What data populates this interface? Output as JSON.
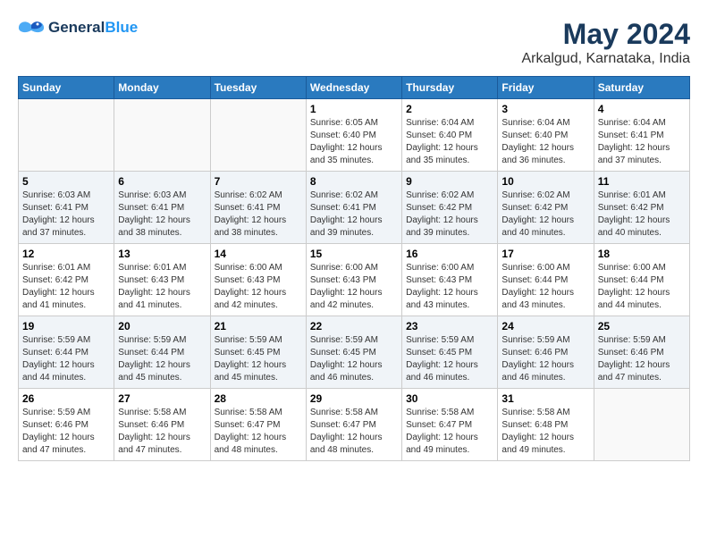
{
  "header": {
    "logo_text_general": "General",
    "logo_text_blue": "Blue",
    "title": "May 2024",
    "subtitle": "Arkalgud, Karnataka, India"
  },
  "calendar": {
    "weekdays": [
      "Sunday",
      "Monday",
      "Tuesday",
      "Wednesday",
      "Thursday",
      "Friday",
      "Saturday"
    ],
    "rows": [
      [
        {
          "day": "",
          "info": ""
        },
        {
          "day": "",
          "info": ""
        },
        {
          "day": "",
          "info": ""
        },
        {
          "day": "1",
          "info": "Sunrise: 6:05 AM\nSunset: 6:40 PM\nDaylight: 12 hours\nand 35 minutes."
        },
        {
          "day": "2",
          "info": "Sunrise: 6:04 AM\nSunset: 6:40 PM\nDaylight: 12 hours\nand 35 minutes."
        },
        {
          "day": "3",
          "info": "Sunrise: 6:04 AM\nSunset: 6:40 PM\nDaylight: 12 hours\nand 36 minutes."
        },
        {
          "day": "4",
          "info": "Sunrise: 6:04 AM\nSunset: 6:41 PM\nDaylight: 12 hours\nand 37 minutes."
        }
      ],
      [
        {
          "day": "5",
          "info": "Sunrise: 6:03 AM\nSunset: 6:41 PM\nDaylight: 12 hours\nand 37 minutes."
        },
        {
          "day": "6",
          "info": "Sunrise: 6:03 AM\nSunset: 6:41 PM\nDaylight: 12 hours\nand 38 minutes."
        },
        {
          "day": "7",
          "info": "Sunrise: 6:02 AM\nSunset: 6:41 PM\nDaylight: 12 hours\nand 38 minutes."
        },
        {
          "day": "8",
          "info": "Sunrise: 6:02 AM\nSunset: 6:41 PM\nDaylight: 12 hours\nand 39 minutes."
        },
        {
          "day": "9",
          "info": "Sunrise: 6:02 AM\nSunset: 6:42 PM\nDaylight: 12 hours\nand 39 minutes."
        },
        {
          "day": "10",
          "info": "Sunrise: 6:02 AM\nSunset: 6:42 PM\nDaylight: 12 hours\nand 40 minutes."
        },
        {
          "day": "11",
          "info": "Sunrise: 6:01 AM\nSunset: 6:42 PM\nDaylight: 12 hours\nand 40 minutes."
        }
      ],
      [
        {
          "day": "12",
          "info": "Sunrise: 6:01 AM\nSunset: 6:42 PM\nDaylight: 12 hours\nand 41 minutes."
        },
        {
          "day": "13",
          "info": "Sunrise: 6:01 AM\nSunset: 6:43 PM\nDaylight: 12 hours\nand 41 minutes."
        },
        {
          "day": "14",
          "info": "Sunrise: 6:00 AM\nSunset: 6:43 PM\nDaylight: 12 hours\nand 42 minutes."
        },
        {
          "day": "15",
          "info": "Sunrise: 6:00 AM\nSunset: 6:43 PM\nDaylight: 12 hours\nand 42 minutes."
        },
        {
          "day": "16",
          "info": "Sunrise: 6:00 AM\nSunset: 6:43 PM\nDaylight: 12 hours\nand 43 minutes."
        },
        {
          "day": "17",
          "info": "Sunrise: 6:00 AM\nSunset: 6:44 PM\nDaylight: 12 hours\nand 43 minutes."
        },
        {
          "day": "18",
          "info": "Sunrise: 6:00 AM\nSunset: 6:44 PM\nDaylight: 12 hours\nand 44 minutes."
        }
      ],
      [
        {
          "day": "19",
          "info": "Sunrise: 5:59 AM\nSunset: 6:44 PM\nDaylight: 12 hours\nand 44 minutes."
        },
        {
          "day": "20",
          "info": "Sunrise: 5:59 AM\nSunset: 6:44 PM\nDaylight: 12 hours\nand 45 minutes."
        },
        {
          "day": "21",
          "info": "Sunrise: 5:59 AM\nSunset: 6:45 PM\nDaylight: 12 hours\nand 45 minutes."
        },
        {
          "day": "22",
          "info": "Sunrise: 5:59 AM\nSunset: 6:45 PM\nDaylight: 12 hours\nand 46 minutes."
        },
        {
          "day": "23",
          "info": "Sunrise: 5:59 AM\nSunset: 6:45 PM\nDaylight: 12 hours\nand 46 minutes."
        },
        {
          "day": "24",
          "info": "Sunrise: 5:59 AM\nSunset: 6:46 PM\nDaylight: 12 hours\nand 46 minutes."
        },
        {
          "day": "25",
          "info": "Sunrise: 5:59 AM\nSunset: 6:46 PM\nDaylight: 12 hours\nand 47 minutes."
        }
      ],
      [
        {
          "day": "26",
          "info": "Sunrise: 5:59 AM\nSunset: 6:46 PM\nDaylight: 12 hours\nand 47 minutes."
        },
        {
          "day": "27",
          "info": "Sunrise: 5:58 AM\nSunset: 6:46 PM\nDaylight: 12 hours\nand 47 minutes."
        },
        {
          "day": "28",
          "info": "Sunrise: 5:58 AM\nSunset: 6:47 PM\nDaylight: 12 hours\nand 48 minutes."
        },
        {
          "day": "29",
          "info": "Sunrise: 5:58 AM\nSunset: 6:47 PM\nDaylight: 12 hours\nand 48 minutes."
        },
        {
          "day": "30",
          "info": "Sunrise: 5:58 AM\nSunset: 6:47 PM\nDaylight: 12 hours\nand 49 minutes."
        },
        {
          "day": "31",
          "info": "Sunrise: 5:58 AM\nSunset: 6:48 PM\nDaylight: 12 hours\nand 49 minutes."
        },
        {
          "day": "",
          "info": ""
        }
      ]
    ]
  }
}
